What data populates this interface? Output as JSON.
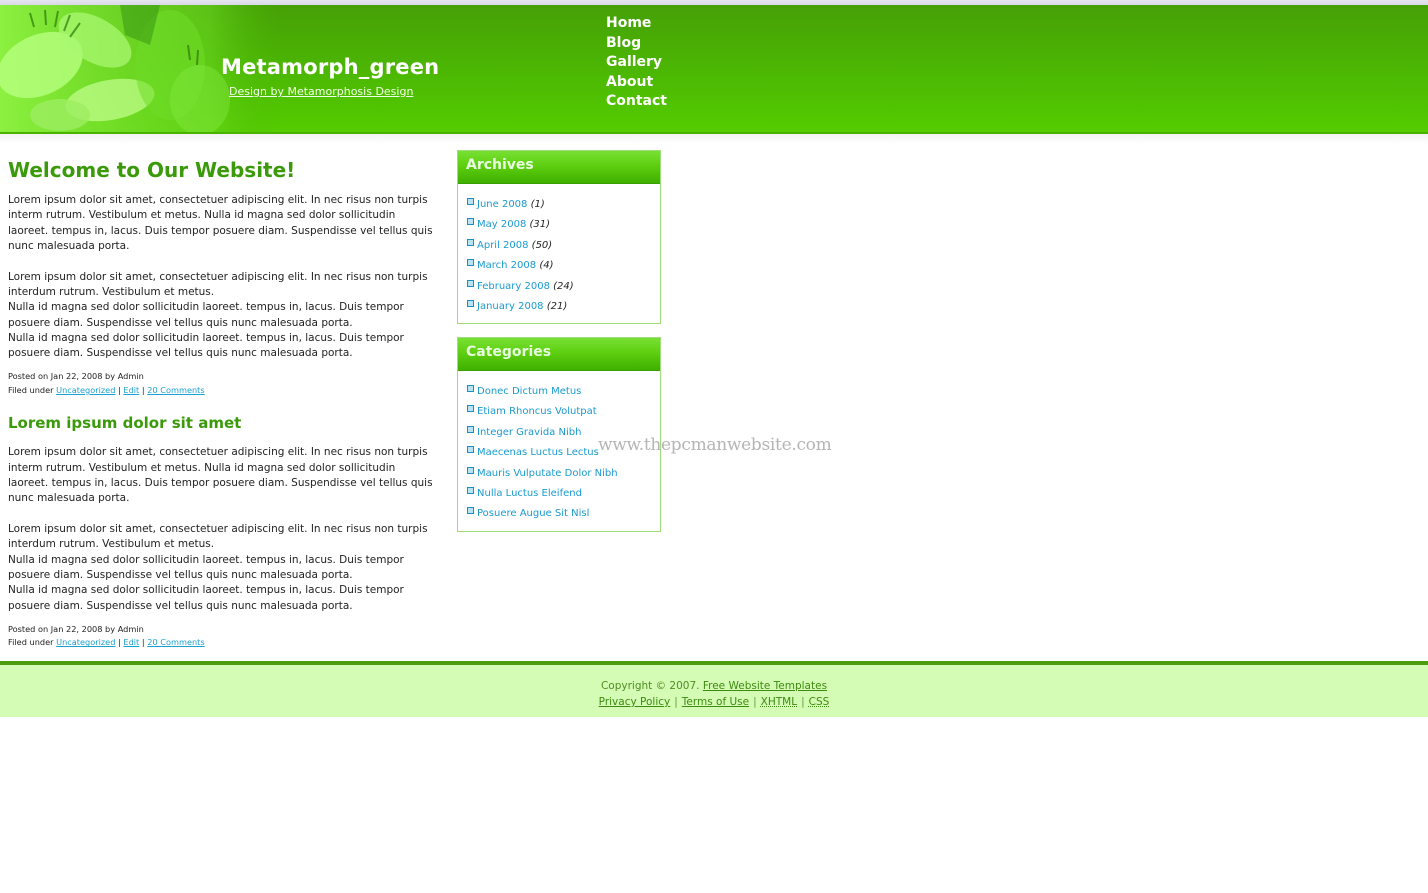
{
  "header": {
    "site_title": "Metamorph_green",
    "site_subtitle": "Design by Metamorphosis Design",
    "nav": [
      "Home",
      "Blog",
      "Gallery",
      "About",
      "Contact"
    ]
  },
  "posts": [
    {
      "title": "Welcome to Our Website!",
      "paragraph1": "Lorem ipsum dolor sit amet, consectetuer adipiscing elit. In nec risus non turpis interm rutrum. Vestibulum et metus. Nulla id magna sed dolor sollicitudin laoreet. tempus in, lacus. Duis tempor posuere diam. Suspendisse vel tellus quis nunc malesuada porta.",
      "paragraph2_lines": [
        "Lorem ipsum dolor sit amet, consectetuer adipiscing elit. In nec risus non turpis interdum rutrum. Vestibulum et metus.",
        "Nulla id magna sed dolor sollicitudin laoreet. tempus in, lacus. Duis tempor posuere diam. Suspendisse vel tellus quis nunc malesuada porta.",
        "Nulla id magna sed dolor sollicitudin laoreet. tempus in, lacus. Duis tempor posuere diam. Suspendisse vel tellus quis nunc malesuada porta."
      ],
      "posted": "Posted on Jan 22, 2008 by Admin",
      "filed_under": "Filed under",
      "category_link": "Uncategorized",
      "edit_link": "Edit",
      "comments_link": "20 Comments"
    },
    {
      "title": "Lorem ipsum dolor sit amet",
      "paragraph1": "Lorem ipsum dolor sit amet, consectetuer adipiscing elit. In nec risus non turpis interm rutrum. Vestibulum et metus. Nulla id magna sed dolor sollicitudin laoreet. tempus in, lacus. Duis tempor posuere diam. Suspendisse vel tellus quis nunc malesuada porta.",
      "paragraph2_lines": [
        "Lorem ipsum dolor sit amet, consectetuer adipiscing elit. In nec risus non turpis interdum rutrum. Vestibulum et metus.",
        "Nulla id magna sed dolor sollicitudin laoreet. tempus in, lacus. Duis tempor posuere diam. Suspendisse vel tellus quis nunc malesuada porta.",
        "Nulla id magna sed dolor sollicitudin laoreet. tempus in, lacus. Duis tempor posuere diam. Suspendisse vel tellus quis nunc malesuada porta."
      ],
      "posted": "Posted on Jan 22, 2008 by Admin",
      "filed_under": "Filed under",
      "category_link": "Uncategorized",
      "edit_link": "Edit",
      "comments_link": "20 Comments"
    }
  ],
  "meta_separator": "|",
  "sidebar": {
    "archives": {
      "title": "Archives",
      "items": [
        {
          "label": "June 2008",
          "count": "(1)"
        },
        {
          "label": "May 2008",
          "count": "(31)"
        },
        {
          "label": "April 2008",
          "count": "(50)"
        },
        {
          "label": "March 2008",
          "count": "(4)"
        },
        {
          "label": "February 2008",
          "count": "(24)"
        },
        {
          "label": "January 2008",
          "count": "(21)"
        }
      ]
    },
    "categories": {
      "title": "Categories",
      "items": [
        "Donec Dictum Metus",
        "Etiam Rhoncus Volutpat",
        "Integer Gravida Nibh",
        "Maecenas Luctus Lectus",
        "Mauris Vulputate Dolor Nibh",
        "Nulla Luctus Eleifend",
        "Posuere Augue Sit Nisl"
      ]
    }
  },
  "watermark": "www.thepcmanwebsite.com",
  "footer": {
    "copyright": "Copyright © 2007.",
    "templates_link": "Free Website Templates",
    "links": [
      "Privacy Policy",
      "Terms of Use",
      "XHTML",
      "CSS"
    ],
    "separator": "|"
  },
  "colors": {
    "header_green": "#4cb803",
    "heading_green": "#3a9a0a",
    "link_blue": "#1a9ad0",
    "footer_bg": "#d4fcb4",
    "footer_text": "#4e8e20"
  }
}
